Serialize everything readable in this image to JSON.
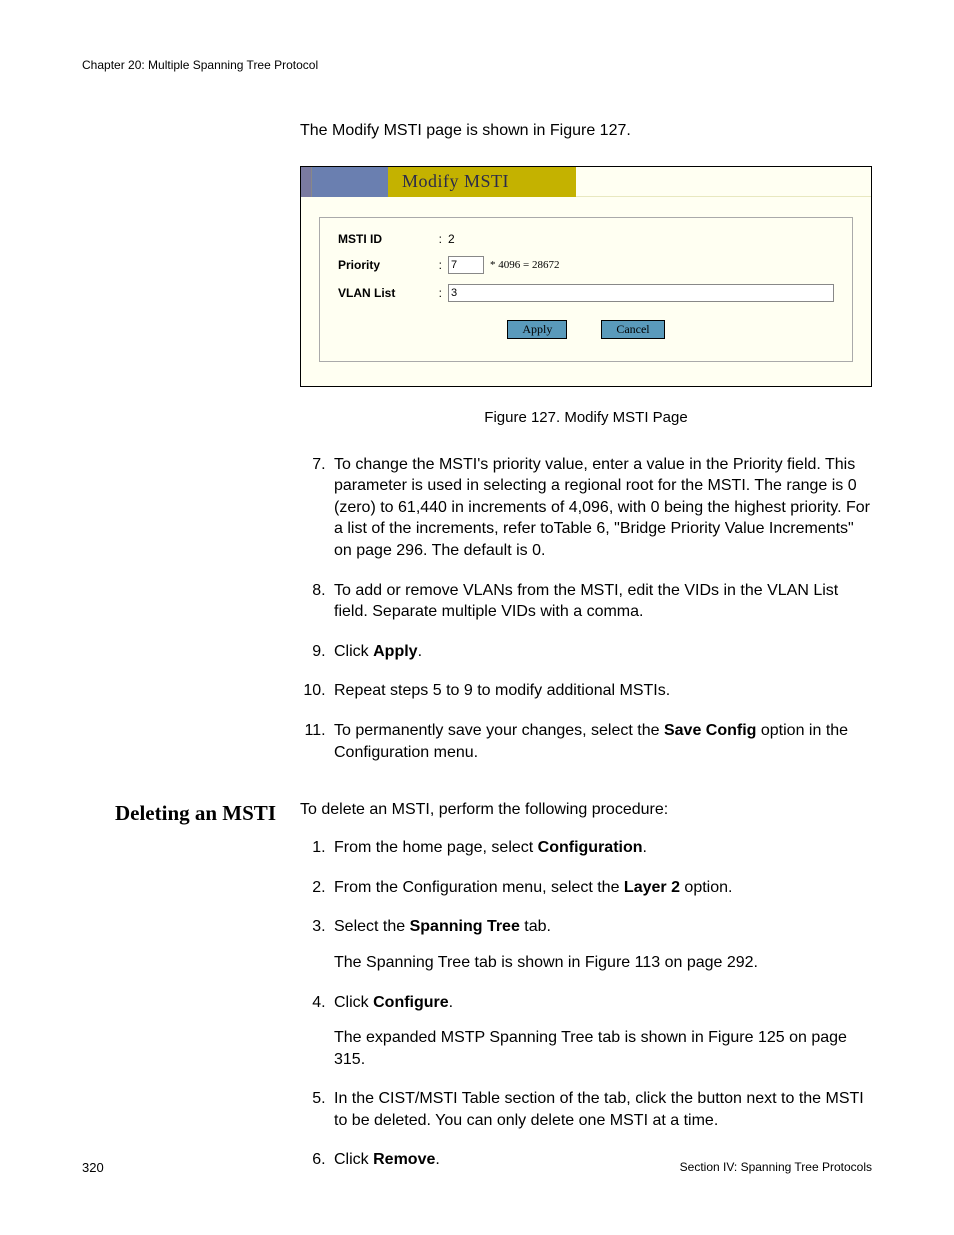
{
  "header": {
    "chapter": "Chapter 20: Multiple Spanning Tree Protocol"
  },
  "intro": "The Modify MSTI page is shown in Figure 127.",
  "figure": {
    "title": "Modify MSTI",
    "fields": {
      "msti_id": {
        "label": "MSTI ID",
        "value": "2"
      },
      "priority": {
        "label": "Priority",
        "value": "7",
        "calc": "* 4096 = 28672"
      },
      "vlan_list": {
        "label": "VLAN List",
        "value": "3"
      }
    },
    "buttons": {
      "apply": "Apply",
      "cancel": "Cancel"
    },
    "caption": "Figure 127. Modify MSTI Page"
  },
  "steps_a": {
    "s7": "To change the MSTI's priority value, enter a value in the Priority field. This parameter is used in selecting a regional root for the MSTI. The range is 0 (zero) to 61,440 in increments of 4,096, with 0 being the highest priority. For a list of the increments, refer toTable 6, \"Bridge Priority Value Increments\" on page 296. The default is 0.",
    "s8": "To add or remove VLANs from the MSTI, edit the VIDs in the VLAN List field. Separate multiple VIDs with a comma.",
    "s9_pre": "Click ",
    "s9_bold": "Apply",
    "s9_post": ".",
    "s10": "Repeat steps 5 to 9 to modify additional MSTIs.",
    "s11_pre": "To permanently save your changes, select the ",
    "s11_bold": "Save Config",
    "s11_post": " option in the Configuration menu."
  },
  "section2": {
    "heading": "Deleting an MSTI",
    "intro": "To delete an MSTI, perform the following procedure:",
    "s1_pre": "From the home page, select ",
    "s1_bold": "Configuration",
    "s1_post": ".",
    "s2_pre": "From the Configuration menu, select the ",
    "s2_bold": "Layer 2",
    "s2_post": " option.",
    "s3_pre": "Select the ",
    "s3_bold": "Spanning Tree",
    "s3_post": " tab.",
    "s3_sub": "The Spanning Tree tab is shown in Figure 113 on page 292.",
    "s4_pre": "Click ",
    "s4_bold": "Configure",
    "s4_post": ".",
    "s4_sub": "The expanded MSTP Spanning Tree tab is shown in Figure 125 on page 315.",
    "s5": "In the CIST/MSTI Table section of the tab, click the button next to the MSTI to be deleted. You can only delete one MSTI at a time.",
    "s6_pre": "Click ",
    "s6_bold": "Remove",
    "s6_post": "."
  },
  "footer": {
    "page": "320",
    "section": "Section IV: Spanning Tree Protocols"
  }
}
